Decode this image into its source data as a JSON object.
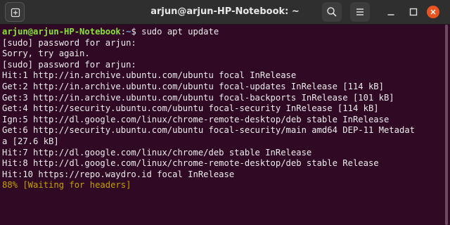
{
  "window": {
    "title": "arjun@arjun-HP-Notebook: ~"
  },
  "titlebar": {
    "icons": {
      "new_tab": "new-tab-icon",
      "search": "search-icon",
      "menu": "hamburger-menu-icon",
      "minimize": "minimize-icon",
      "maximize": "maximize-icon",
      "close": "close-icon"
    }
  },
  "colors": {
    "terminal_bg": "#300a24",
    "prompt_user": "#8ae234",
    "prompt_path": "#729fcf",
    "progress": "#c4a000",
    "close_button": "#e95420"
  },
  "terminal": {
    "prompt_user": "arjun@arjun-HP-Notebook",
    "prompt_sep": ":",
    "prompt_path": "~",
    "prompt_symbol": "$",
    "command": " sudo apt update",
    "lines": [
      "[sudo] password for arjun:",
      "Sorry, try again.",
      "[sudo] password for arjun:",
      "Hit:1 http://in.archive.ubuntu.com/ubuntu focal InRelease",
      "Get:2 http://in.archive.ubuntu.com/ubuntu focal-updates InRelease [114 kB]",
      "Get:3 http://in.archive.ubuntu.com/ubuntu focal-backports InRelease [101 kB]",
      "Get:4 http://security.ubuntu.com/ubuntu focal-security InRelease [114 kB]",
      "Ign:5 http://dl.google.com/linux/chrome-remote-desktop/deb stable InRelease",
      "Get:6 http://security.ubuntu.com/ubuntu focal-security/main amd64 DEP-11 Metadat",
      "a [27.6 kB]",
      "Hit:7 http://dl.google.com/linux/chrome/deb stable InRelease",
      "Hit:8 http://dl.google.com/linux/chrome-remote-desktop/deb stable Release",
      "Hit:10 https://repo.waydro.id focal InRelease"
    ],
    "progress_line": "88% [Waiting for headers]"
  }
}
